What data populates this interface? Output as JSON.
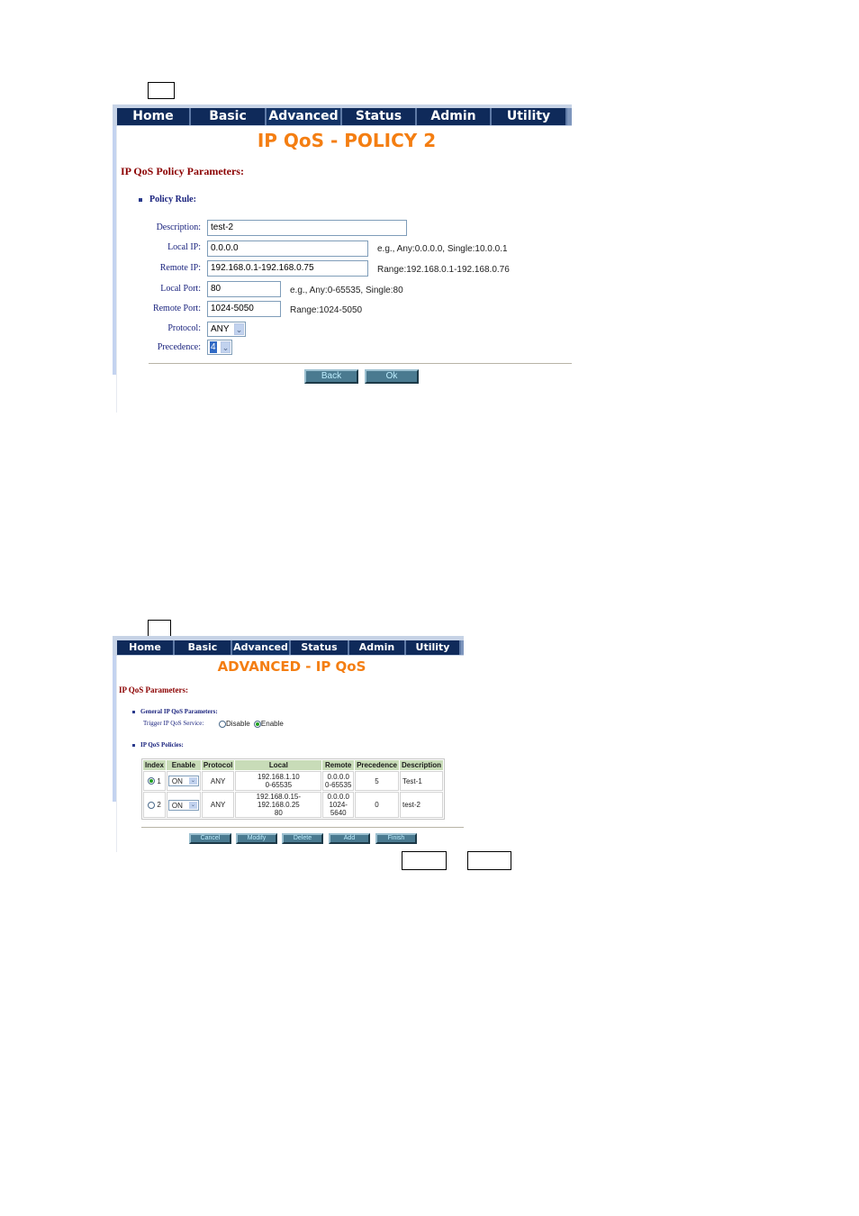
{
  "annotations": {
    "top_box": "",
    "bottom_box_1": "",
    "bottom_box_2": "",
    "bottom_box_3": ""
  },
  "nav": {
    "items": [
      "Home",
      "Basic",
      "Advanced",
      "Status",
      "Admin",
      "Utility"
    ]
  },
  "policy_page": {
    "title": "IP QoS - POLICY 2",
    "section_title": "IP QoS Policy Parameters:",
    "policy_rule_label": "Policy Rule:",
    "fields": {
      "description": {
        "label": "Description:",
        "value": "test-2"
      },
      "local_ip": {
        "label": "Local IP:",
        "value": "0.0.0.0",
        "hint": "e.g., Any:0.0.0.0, Single:10.0.0.1"
      },
      "remote_ip": {
        "label": "Remote IP:",
        "value": "192.168.0.1-192.168.0.75",
        "hint": "Range:192.168.0.1-192.168.0.76"
      },
      "local_port": {
        "label": "Local Port:",
        "value": "80",
        "hint": "e.g., Any:0-65535, Single:80"
      },
      "remote_port": {
        "label": "Remote Port:",
        "value": "1024-5050",
        "hint": "Range:1024-5050"
      },
      "protocol": {
        "label": "Protocol:",
        "value": "ANY"
      },
      "precedence": {
        "label": "Precedence:",
        "value": "4"
      }
    },
    "buttons": {
      "back": "Back",
      "ok": "Ok"
    }
  },
  "advanced_page": {
    "title": "ADVANCED - IP QoS",
    "section_title": "IP QoS Parameters:",
    "general_label": "General IP QoS Parameters:",
    "trigger_label": "Trigger IP QoS Service:",
    "trigger_options": [
      {
        "label": "Disable",
        "checked": false
      },
      {
        "label": "Enable",
        "checked": true
      }
    ],
    "policies_label": "IP QoS Policies:",
    "table": {
      "headers": [
        "Index",
        "Enable",
        "Protocol",
        "Local",
        "Remote",
        "Precedence",
        "Description"
      ],
      "rows": [
        {
          "index": "1",
          "selected": true,
          "enable": "ON",
          "protocol": "ANY",
          "local_ip": "192.168.1.10",
          "local_port": "0-65535",
          "remote_ip": "0.0.0.0",
          "remote_port": "0-65535",
          "precedence": "5",
          "description": "Test-1"
        },
        {
          "index": "2",
          "selected": false,
          "enable": "ON",
          "protocol": "ANY",
          "local_ip": "192.168.0.15-192.168.0.25",
          "local_port": "80",
          "remote_ip": "0.0.0.0",
          "remote_port": "1024-5640",
          "precedence": "0",
          "description": "test-2"
        }
      ]
    },
    "buttons": {
      "cancel": "Cancel",
      "modify": "Modify",
      "delete": "Delete",
      "add": "Add",
      "finish": "Finish"
    }
  }
}
